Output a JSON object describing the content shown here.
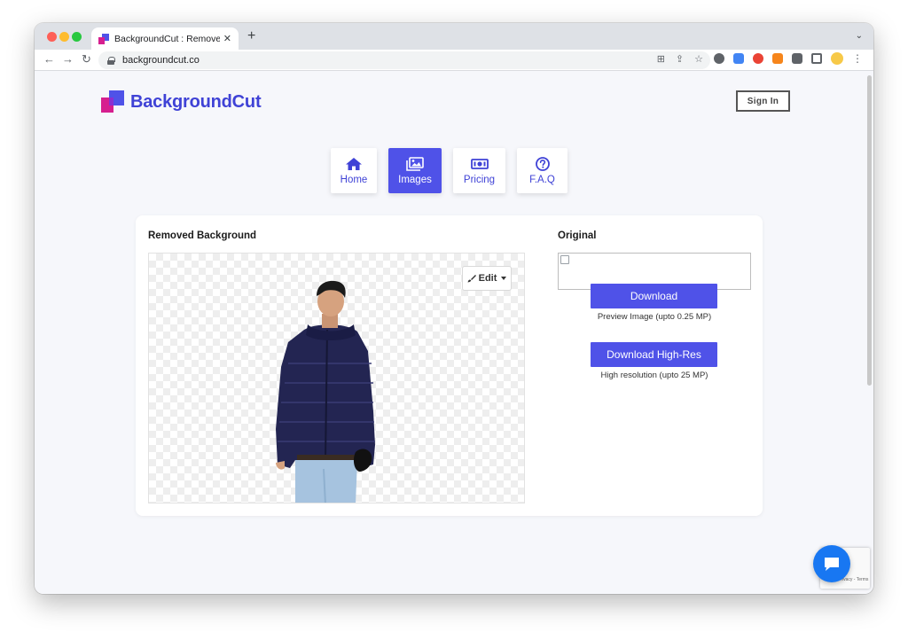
{
  "browser": {
    "tab_title": "BackgroundCut : Remove Back",
    "url": "backgroundcut.co"
  },
  "header": {
    "brand": "BackgroundCut",
    "sign_in": "Sign In"
  },
  "nav": [
    {
      "label": "Home",
      "icon": "home-icon",
      "active": false
    },
    {
      "label": "Images",
      "icon": "images-icon",
      "active": true
    },
    {
      "label": "Pricing",
      "icon": "money-bill-icon",
      "active": false
    },
    {
      "label": "F.A.Q",
      "icon": "question-circle-icon",
      "active": false
    }
  ],
  "result": {
    "heading": "Removed Background",
    "edit_label": "Edit"
  },
  "original": {
    "heading": "Original",
    "download_label": "Download",
    "download_note": "Preview Image (upto 0.25 MP)",
    "download_hires_label": "Download High-Res",
    "download_hires_note": "High resolution (upto 25 MP)"
  },
  "recaptcha": {
    "text": "Privacy - Terms"
  },
  "colors": {
    "brand": "#3f42d6",
    "accent": "#4f52e8",
    "chat": "#1877f2"
  }
}
